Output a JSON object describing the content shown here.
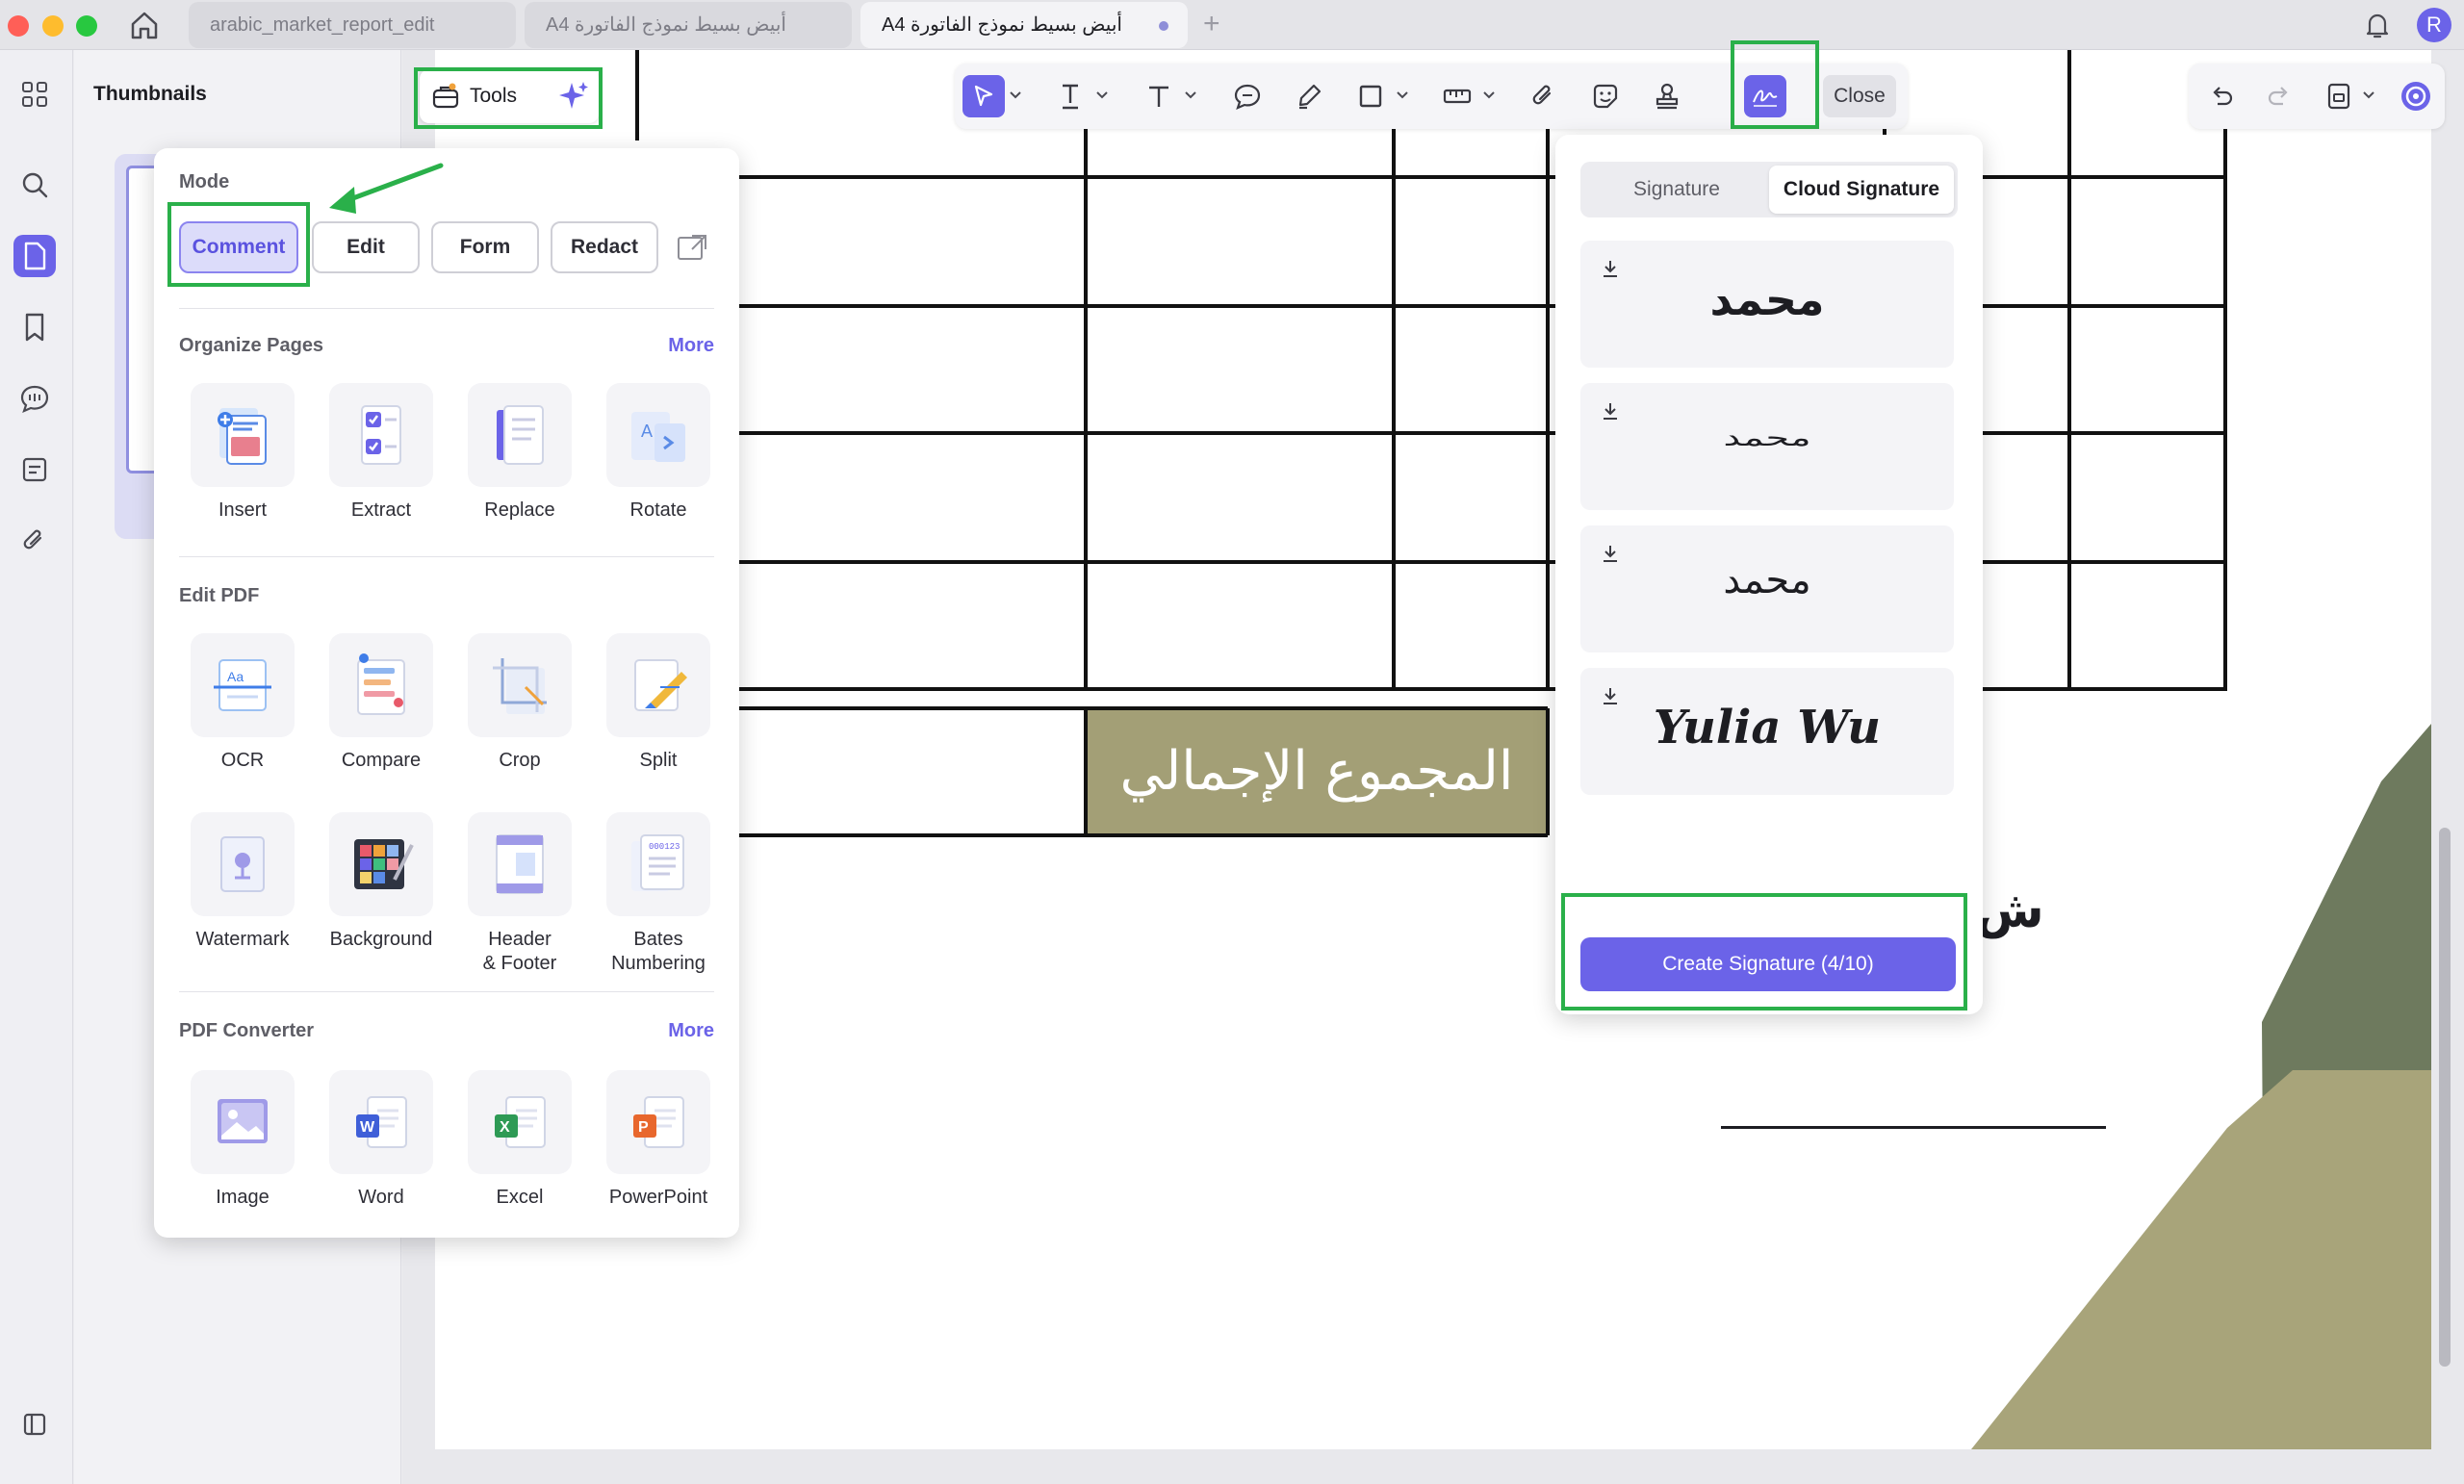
{
  "window": {
    "tabs": [
      {
        "label": "arabic_market_report_edit"
      },
      {
        "label": "A4 أبيض بسيط نموذج الفاتورة"
      },
      {
        "label": "A4 أبيض بسيط نموذج الفاتورة"
      }
    ],
    "user_initial": "R"
  },
  "sidebar": {
    "title": "Thumbnails",
    "icons": [
      "apps-icon",
      "search-icon",
      "pages-icon",
      "bookmark-icon",
      "comment-icon",
      "form-icon",
      "attachment-icon",
      "sidebar-toggle-icon"
    ]
  },
  "tools_button": {
    "label": "Tools"
  },
  "toolbar": {
    "close_label": "Close",
    "icons": [
      "select-icon",
      "text-underline-icon",
      "text-icon",
      "comment-bubble-icon",
      "highlighter-icon",
      "rectangle-icon",
      "measure-icon",
      "attachment-icon",
      "sticker-icon",
      "stamp-icon",
      "signature-icon"
    ]
  },
  "tools_panel": {
    "mode": {
      "title": "Mode",
      "buttons": [
        {
          "label": "Comment",
          "active": true
        },
        {
          "label": "Edit"
        },
        {
          "label": "Form"
        },
        {
          "label": "Redact"
        }
      ]
    },
    "organize": {
      "title": "Organize Pages",
      "more": "More",
      "items": [
        {
          "label": "Insert"
        },
        {
          "label": "Extract"
        },
        {
          "label": "Replace"
        },
        {
          "label": "Rotate"
        }
      ]
    },
    "edit_pdf": {
      "title": "Edit PDF",
      "items": [
        {
          "label": "OCR"
        },
        {
          "label": "Compare"
        },
        {
          "label": "Crop"
        },
        {
          "label": "Split"
        },
        {
          "label": "Watermark"
        },
        {
          "label": "Background"
        },
        {
          "label": "Header\n& Footer"
        },
        {
          "label": "Bates\nNumbering"
        }
      ]
    },
    "converter": {
      "title": "PDF Converter",
      "more": "More",
      "items": [
        {
          "label": "Image"
        },
        {
          "label": "Word"
        },
        {
          "label": "Excel"
        },
        {
          "label": "PowerPoint"
        }
      ]
    }
  },
  "signature_panel": {
    "tabs": [
      {
        "label": "Signature"
      },
      {
        "label": "Cloud Signature",
        "active": true
      }
    ],
    "signatures": [
      {
        "text": "محمد"
      },
      {
        "text": "محمد"
      },
      {
        "text": "محمد"
      },
      {
        "text": "Yulia Wu"
      }
    ],
    "create_label": "Create Signature (4/10)"
  },
  "document": {
    "total_label": "المجموع الإجمالي",
    "partial_text": "ش"
  },
  "colors": {
    "accent": "#6b63e8",
    "highlight": "#2ab04a",
    "total_cell": "#a39f76",
    "shape_dark": "#6e7a5e",
    "shape_light": "#a8a47a"
  }
}
